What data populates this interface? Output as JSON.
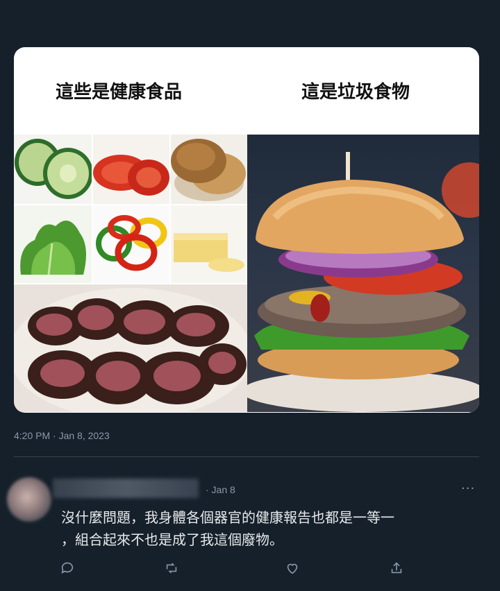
{
  "meme": {
    "left_heading": "這些是健康食品",
    "right_heading": "這是垃圾食物"
  },
  "tweet": {
    "timestamp": "4:20 PM · Jan 8, 2023"
  },
  "reply": {
    "date": "· Jan 8",
    "more_label": "···",
    "text": "沒什麼問題，我身體各個器官的健康報告也都是一等一\n，組合起來不也是成了我這個廢物。"
  },
  "actions": [
    {
      "icon": "comment-icon"
    },
    {
      "icon": "retweet-icon"
    },
    {
      "icon": "like-icon"
    },
    {
      "icon": "share-icon"
    }
  ],
  "colors": {
    "background": "#15202b",
    "muted_text": "#8b98a5",
    "divider": "#38444d"
  }
}
